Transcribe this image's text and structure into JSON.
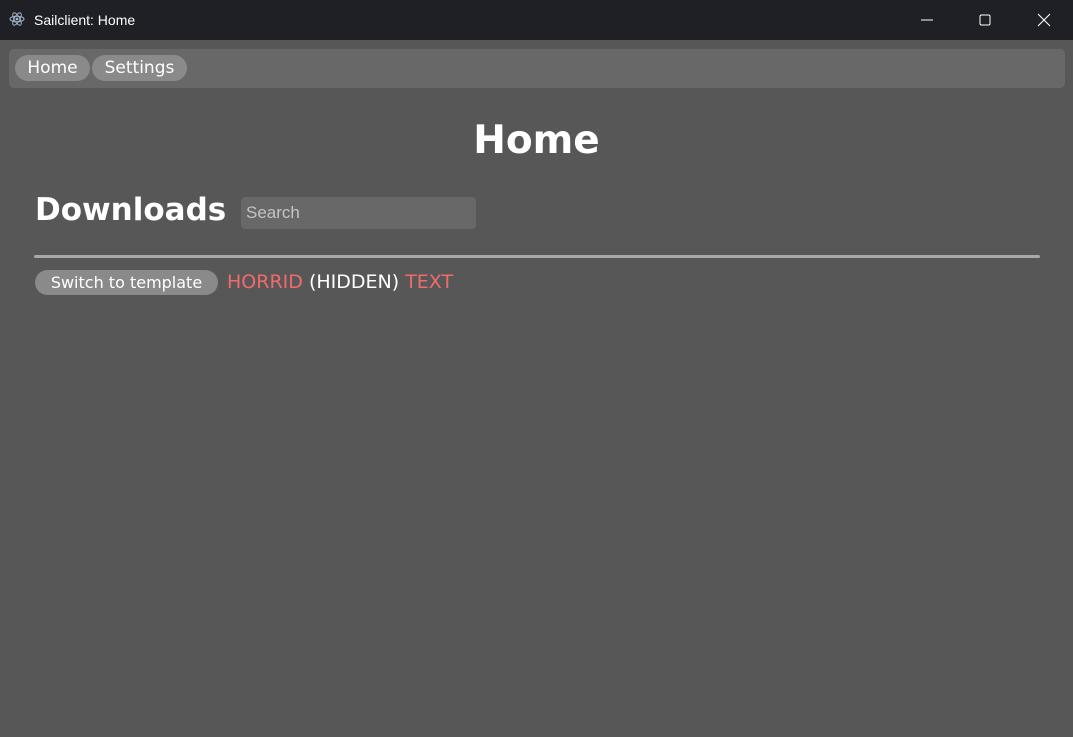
{
  "window": {
    "title": "Sailclient: Home",
    "icon": "electron-icon"
  },
  "nav": {
    "items": [
      {
        "label": "Home"
      },
      {
        "label": "Settings"
      }
    ]
  },
  "main": {
    "title": "Home",
    "section_heading": "Downloads",
    "search": {
      "placeholder": "Search",
      "value": ""
    },
    "switch_button_label": "Switch to template",
    "status": {
      "part1": "HORRID",
      "part2": "(HIDDEN)",
      "part3": "TEXT"
    }
  },
  "colors": {
    "background": "#575757",
    "titlebar": "#1f1f26",
    "navbar": "#686868",
    "pill": "#8a8a8a",
    "accent_red": "#f26b6b"
  }
}
